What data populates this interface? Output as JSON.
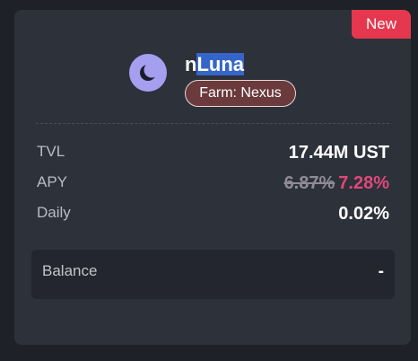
{
  "badge": {
    "label": "New"
  },
  "token": {
    "name_prefix": "n",
    "name_selected": "Luna",
    "icon": "luna-moon-icon",
    "icon_color": "#a59ff0",
    "farm_label": "Farm: Nexus"
  },
  "stats": {
    "tvl_label": "TVL",
    "tvl_value": "17.44M UST",
    "apy_label": "APY",
    "apy_old": "6.87%",
    "apy_new": "7.28%",
    "daily_label": "Daily",
    "daily_value": "0.02%"
  },
  "balance": {
    "label": "Balance",
    "value": "-"
  },
  "colors": {
    "badge": "#e5384e",
    "apy_new": "#e0487b",
    "apy_old": "#8e8b97",
    "card": "#2d313a",
    "background": "#1f2128"
  }
}
